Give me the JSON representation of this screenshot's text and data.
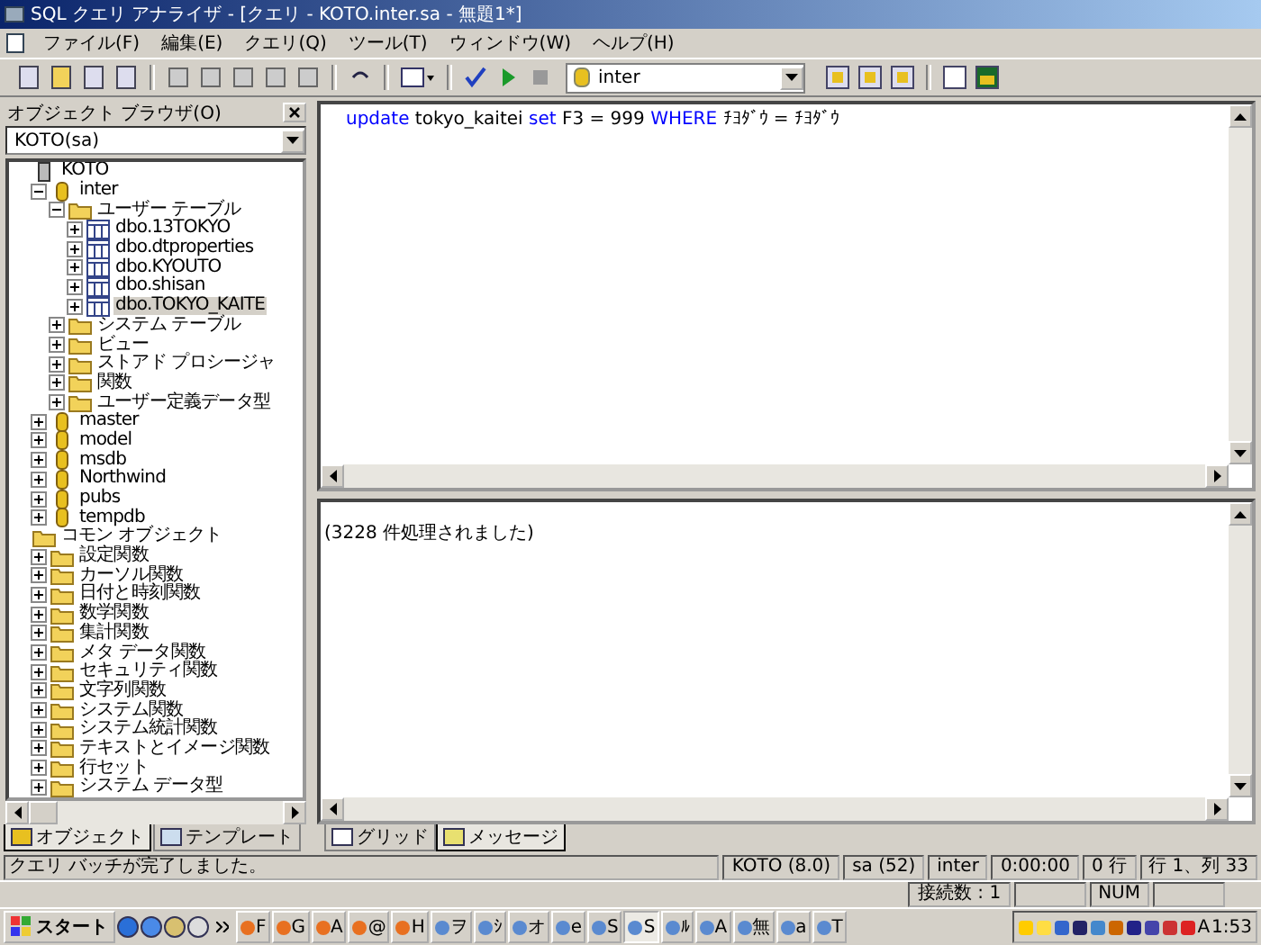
{
  "window": {
    "title": "SQL クエリ アナライザ - [クエリ - KOTO.inter.sa - 無題1*]"
  },
  "menu": [
    "ファイル(F)",
    "編集(E)",
    "クエリ(Q)",
    "ツール(T)",
    "ウィンドウ(W)",
    "ヘルプ(H)"
  ],
  "toolbar": {
    "database": "inter"
  },
  "object_browser": {
    "title": "オブジェクト ブラウザ(O)",
    "server": "KOTO(sa)",
    "tree": [
      {
        "label": "KOTO",
        "kind": "server",
        "selected": false,
        "children": [
          {
            "label": "inter",
            "kind": "db",
            "expanded": true,
            "selected": false,
            "children": [
              {
                "label": "ユーザー テーブル",
                "kind": "folder",
                "expanded": true,
                "selected": false,
                "children": [
                  {
                    "label": "dbo.13TOKYO",
                    "kind": "table",
                    "expanded": false,
                    "selected": false
                  },
                  {
                    "label": "dbo.dtproperties",
                    "kind": "table",
                    "expanded": false,
                    "selected": false
                  },
                  {
                    "label": "dbo.KYOUTO",
                    "kind": "table",
                    "expanded": false,
                    "selected": false
                  },
                  {
                    "label": "dbo.shisan",
                    "kind": "table",
                    "expanded": false,
                    "selected": false
                  },
                  {
                    "label": "dbo.TOKYO_KAITE",
                    "kind": "table",
                    "expanded": false,
                    "selected": true
                  }
                ]
              },
              {
                "label": "システム テーブル",
                "kind": "folder",
                "expanded": false,
                "selected": false
              },
              {
                "label": "ビュー",
                "kind": "folder",
                "expanded": false,
                "selected": false
              },
              {
                "label": "ストアド プロシージャ",
                "kind": "folder",
                "expanded": false,
                "selected": false
              },
              {
                "label": "関数",
                "kind": "folder",
                "expanded": false,
                "selected": false
              },
              {
                "label": "ユーザー定義データ型",
                "kind": "folder",
                "expanded": false,
                "selected": false
              }
            ]
          },
          {
            "label": "master",
            "kind": "db",
            "expanded": false,
            "selected": false
          },
          {
            "label": "model",
            "kind": "db",
            "expanded": false,
            "selected": false
          },
          {
            "label": "msdb",
            "kind": "db",
            "expanded": false,
            "selected": false
          },
          {
            "label": "Northwind",
            "kind": "db",
            "expanded": false,
            "selected": false
          },
          {
            "label": "pubs",
            "kind": "db",
            "expanded": false,
            "selected": false
          },
          {
            "label": "tempdb",
            "kind": "db",
            "expanded": false,
            "selected": false
          }
        ]
      },
      {
        "label": "コモン オブジェクト",
        "kind": "folder",
        "selected": false,
        "children": [
          {
            "label": "設定関数",
            "kind": "folder",
            "expanded": false,
            "selected": false
          },
          {
            "label": "カーソル関数",
            "kind": "folder",
            "expanded": false,
            "selected": false
          },
          {
            "label": "日付と時刻関数",
            "kind": "folder",
            "expanded": false,
            "selected": false
          },
          {
            "label": "数学関数",
            "kind": "folder",
            "expanded": false,
            "selected": false
          },
          {
            "label": "集計関数",
            "kind": "folder",
            "expanded": false,
            "selected": false
          },
          {
            "label": "メタ データ関数",
            "kind": "folder",
            "expanded": false,
            "selected": false
          },
          {
            "label": "セキュリティ関数",
            "kind": "folder",
            "expanded": false,
            "selected": false
          },
          {
            "label": "文字列関数",
            "kind": "folder",
            "expanded": false,
            "selected": false
          },
          {
            "label": "システム関数",
            "kind": "folder",
            "expanded": false,
            "selected": false
          },
          {
            "label": "システム統計関数",
            "kind": "folder",
            "expanded": false,
            "selected": false
          },
          {
            "label": "テキストとイメージ関数",
            "kind": "folder",
            "expanded": false,
            "selected": false
          },
          {
            "label": "行セット",
            "kind": "folder",
            "expanded": false,
            "selected": false
          },
          {
            "label": "システム データ型",
            "kind": "folder",
            "expanded": false,
            "selected": false
          }
        ]
      }
    ],
    "tabs": [
      {
        "label": "オブジェクト",
        "selected": true
      },
      {
        "label": "テンプレート",
        "selected": false
      }
    ]
  },
  "editor": {
    "tokens": [
      {
        "text": "update",
        "kind": "keyword"
      },
      {
        "text": " tokyo_kaitei ",
        "kind": "text"
      },
      {
        "text": "set",
        "kind": "keyword"
      },
      {
        "text": " F3 = 999 ",
        "kind": "text"
      },
      {
        "text": "WHERE",
        "kind": "keyword"
      },
      {
        "text": " ﾁﾖﾀﾞｳ = ﾁﾖﾀﾞｳ",
        "kind": "text"
      }
    ]
  },
  "results": {
    "message": "(3228 件処理されました)",
    "tabs": [
      {
        "label": "グリッド",
        "selected": false
      },
      {
        "label": "メッセージ",
        "selected": true
      }
    ]
  },
  "status_bar": {
    "message": "クエリ バッチが完了しました。",
    "panels": [
      "KOTO (8.0)",
      "sa (52)",
      "inter",
      "0:00:00",
      "0 行",
      "行 1、列 33"
    ],
    "panels_2": [
      "接続数 : 1",
      "NUM"
    ]
  },
  "taskbar": {
    "start": "スタート",
    "buttons": [
      {
        "label": "F",
        "selected": false
      },
      {
        "label": "G",
        "selected": false
      },
      {
        "label": "A",
        "selected": false
      },
      {
        "label": "@",
        "selected": false
      },
      {
        "label": "H",
        "selected": false
      },
      {
        "label": "ヲ",
        "selected": false
      },
      {
        "label": "ｼ",
        "selected": false
      },
      {
        "label": "オ",
        "selected": false
      },
      {
        "label": "e",
        "selected": false
      },
      {
        "label": "S",
        "selected": false
      },
      {
        "label": "S",
        "selected": true
      },
      {
        "label": "ﾙ",
        "selected": false
      },
      {
        "label": "A",
        "selected": false
      },
      {
        "label": "無",
        "selected": false
      },
      {
        "label": "a",
        "selected": false
      },
      {
        "label": "T",
        "selected": false
      }
    ],
    "tray_text": "A",
    "clock": "1:53"
  }
}
